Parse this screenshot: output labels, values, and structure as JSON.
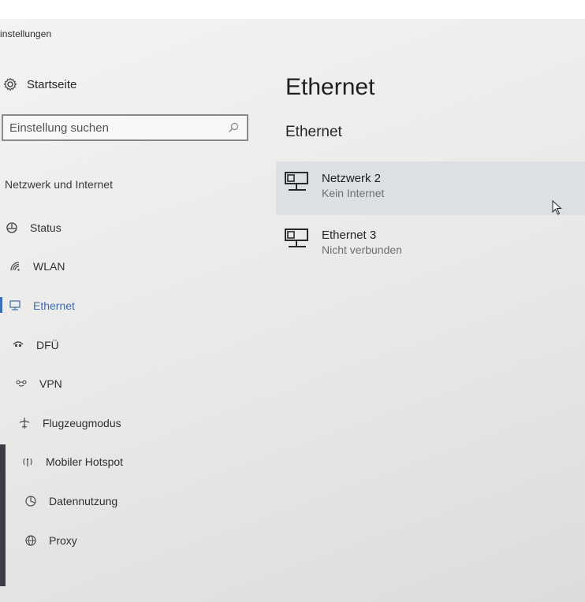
{
  "window": {
    "title": "instellungen"
  },
  "sidebar": {
    "home_label": "Startseite",
    "search": {
      "placeholder": "Einstellung suchen"
    },
    "section_header": "Netzwerk und Internet",
    "items": [
      {
        "label": "Status",
        "icon": "status-icon"
      },
      {
        "label": "WLAN",
        "icon": "wlan-icon"
      },
      {
        "label": "Ethernet",
        "icon": "ethernet-icon",
        "active": true
      },
      {
        "label": "DFÜ",
        "icon": "dialup-icon"
      },
      {
        "label": "VPN",
        "icon": "vpn-icon"
      },
      {
        "label": "Flugzeugmodus",
        "icon": "airplane-icon"
      },
      {
        "label": "Mobiler Hotspot",
        "icon": "hotspot-icon"
      },
      {
        "label": "Datennutzung",
        "icon": "data-usage-icon"
      },
      {
        "label": "Proxy",
        "icon": "globe-icon"
      }
    ]
  },
  "main": {
    "title": "Ethernet",
    "subtitle": "Ethernet",
    "networks": [
      {
        "name": "Netzwerk  2",
        "status": "Kein Internet",
        "selected": true
      },
      {
        "name": "Ethernet 3",
        "status": "Nicht verbunden",
        "selected": false
      }
    ]
  },
  "colors": {
    "accent": "#3b6fb5",
    "selection": "#dcdfe3",
    "background": "#ececeb",
    "text": "#262626"
  }
}
